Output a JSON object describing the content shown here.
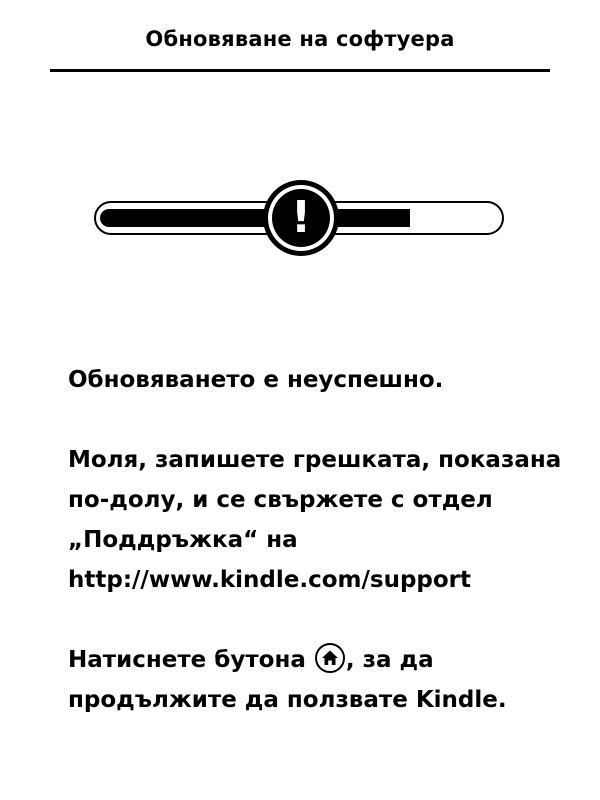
{
  "header": {
    "title": "Обновяване на софтуера"
  },
  "progress": {
    "fraction": 0.78,
    "alert_icon_glyph": "!"
  },
  "message": {
    "line1": "Обновяването е неуспешно.",
    "para2": [
      "Моля, запишете грешката, показана",
      "по-долу, и се свържете с отдел",
      "„Поддръжка“ на",
      "http://www.kindle.com/support"
    ],
    "para3_before": "Натиснете бутона ",
    "para3_after": ", за да",
    "para3_line2": "продължите да ползвате Kindle."
  },
  "icons": {
    "alert": "exclamation-circle-icon",
    "home": "home-icon"
  }
}
